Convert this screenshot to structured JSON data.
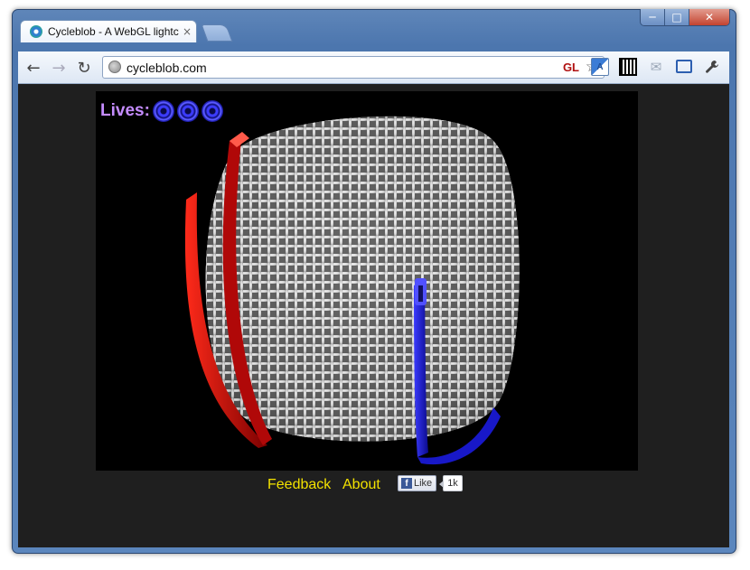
{
  "window": {
    "controls": {
      "minimize": "─",
      "maximize": "□",
      "close": "✕"
    }
  },
  "tab": {
    "title": "Cycleblob - A WebGL lightcycle game",
    "close": "×",
    "favicon": "cycleblob-favicon"
  },
  "toolbar": {
    "back_icon": "←",
    "forward_icon": "→",
    "reload_icon": "↻",
    "url": "cycleblob.com",
    "gl_badge": "GL",
    "star_icon": "☆",
    "extensions": [
      "translate-icon",
      "qr-code-icon",
      "mail-icon",
      "fullscreen-icon",
      "wrench-icon"
    ],
    "mail_glyph": "✉",
    "wrench_glyph": "🔧"
  },
  "game": {
    "lives_label": "Lives:",
    "lives_count": 3,
    "colors": {
      "player1": "#e01010",
      "player2": "#1a1ae0",
      "lives_text": "#c58cff",
      "blob": "#ffffff"
    }
  },
  "footer": {
    "links": [
      {
        "label": "Feedback"
      },
      {
        "label": "About"
      }
    ],
    "like_label": "Like",
    "like_count": "1k",
    "link_color": "#f2e100"
  }
}
